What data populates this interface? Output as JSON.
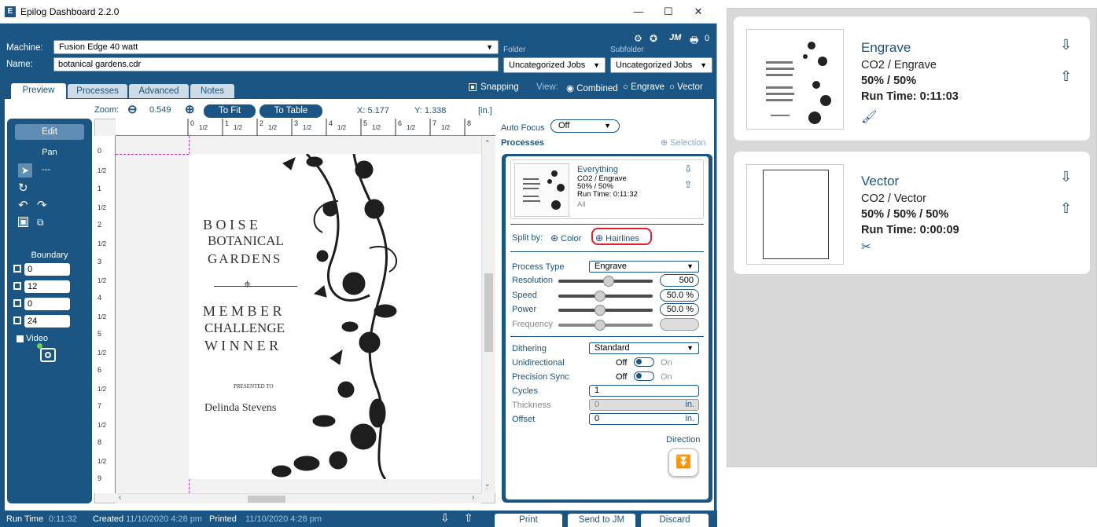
{
  "window": {
    "title": "Epilog Dashboard 2.2.0",
    "minimize": "—",
    "maximize": "☐",
    "close": "✕"
  },
  "header": {
    "machine_label": "Machine:",
    "machine_value": "Fusion Edge 40 watt",
    "name_label": "Name:",
    "name_value": "botanical gardens.cdr",
    "folder_label": "Folder",
    "folder_value": "Uncategorized Jobs",
    "subfolder_label": "Subfolder",
    "subfolder_value": "Uncategorized Jobs",
    "user_initials": "JM",
    "printer_count": "0"
  },
  "tabs": [
    {
      "label": "Preview"
    },
    {
      "label": "Processes"
    },
    {
      "label": "Advanced"
    },
    {
      "label": "Notes"
    }
  ],
  "view": {
    "snapping_label": "Snapping",
    "view_label": "View:",
    "combined": "Combined",
    "engrave": "Engrave",
    "vector": "Vector"
  },
  "zoom": {
    "label": "Zoom:",
    "value": "0.549",
    "to_fit": "To Fit",
    "to_table": "To Table",
    "x_label": "X:",
    "x_value": "5.177",
    "y_label": "Y:",
    "y_value": "1.338",
    "units": "[in.]"
  },
  "ruler": {
    "h": [
      "0",
      "1/2",
      "1",
      "1/2",
      "2",
      "1/2",
      "3",
      "1/2",
      "4",
      "1/2",
      "5",
      "1/2",
      "6",
      "1/2",
      "7",
      "1/2",
      "8"
    ],
    "v": [
      "0",
      "1/2",
      "1",
      "1/2",
      "2",
      "1/2",
      "3",
      "1/2",
      "4",
      "1/2",
      "5",
      "1/2",
      "6",
      "1/2",
      "7",
      "1/2",
      "8",
      "1/2",
      "9"
    ]
  },
  "toolpanel": {
    "edit": "Edit",
    "pan": "Pan",
    "select_value": "---",
    "boundary": "Boundary",
    "boundary_values": [
      "0",
      "12",
      "0",
      "24"
    ],
    "video": "Video"
  },
  "artwork": {
    "line1": "B O I S E",
    "line2": "BOTANICAL",
    "line3": "GARDENS",
    "line4": "M E M B E R",
    "line5": "CHALLENGE",
    "line6": "W I N N E R",
    "presented": "PRESENTED TO",
    "name": "Delinda Stevens"
  },
  "processes": {
    "autofocus_label": "Auto Focus",
    "autofocus_value": "Off",
    "header": "Processes",
    "selection": "Selection",
    "item_title": "Everything",
    "item_line1": "CO2 / Engrave",
    "item_line2": "50% / 50%",
    "item_line3": "Run Time: 0:11:32",
    "item_line4": "All",
    "split_by": "Split by:",
    "split_color": "Color",
    "split_hairlines": "Hairlines",
    "process_type_label": "Process Type",
    "process_type_value": "Engrave",
    "resolution_label": "Resolution",
    "resolution_value": "500",
    "speed_label": "Speed",
    "speed_value": "50.0",
    "power_label": "Power",
    "power_value": "50.0",
    "percent": "%",
    "frequency_label": "Frequency",
    "dithering_label": "Dithering",
    "dithering_value": "Standard",
    "unidirectional_label": "Unidirectional",
    "precision_label": "Precision Sync",
    "off": "Off",
    "on": "On",
    "cycles_label": "Cycles",
    "cycles_value": "1",
    "thickness_label": "Thickness",
    "thickness_value": "0",
    "offset_label": "Offset",
    "offset_value": "0",
    "unit_in": "in.",
    "direction_label": "Direction",
    "resolution_level": 0.6,
    "speed_level": 0.5,
    "power_level": 0.5,
    "frequency_level": 0.5
  },
  "footer": {
    "run_time_label": "Run Time",
    "run_time_value": "0:11:32",
    "created_label": "Created",
    "created_value": "11/10/2020 4:28 pm",
    "printed_label": "Printed",
    "printed_value": "11/10/2020 4:28 pm",
    "print": "Print",
    "send_to_jm": "Send to JM",
    "discard": "Discard"
  },
  "side_cards": [
    {
      "title": "Engrave",
      "line1": "CO2 / Engrave",
      "line2": "50% / 50%",
      "line3": "Run Time: 0:11:03"
    },
    {
      "title": "Vector",
      "line1": "CO2 / Vector",
      "line2": "50% / 50% / 50%",
      "line3": "Run Time: 0:00:09"
    }
  ]
}
